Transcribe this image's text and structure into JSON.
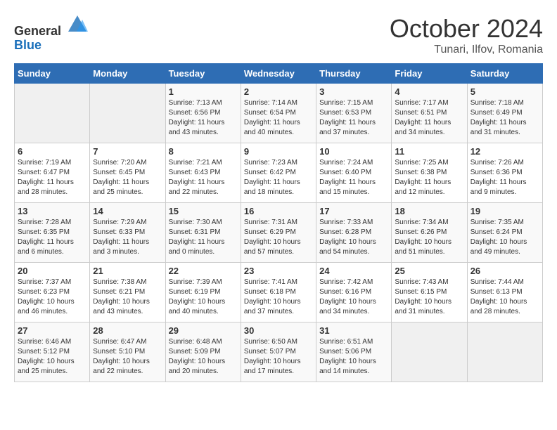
{
  "header": {
    "logo_general": "General",
    "logo_blue": "Blue",
    "month": "October 2024",
    "location": "Tunari, Ilfov, Romania"
  },
  "days_of_week": [
    "Sunday",
    "Monday",
    "Tuesday",
    "Wednesday",
    "Thursday",
    "Friday",
    "Saturday"
  ],
  "weeks": [
    [
      {
        "day": "",
        "empty": true
      },
      {
        "day": "",
        "empty": true
      },
      {
        "day": "1",
        "sunrise": "Sunrise: 7:13 AM",
        "sunset": "Sunset: 6:56 PM",
        "daylight": "Daylight: 11 hours and 43 minutes."
      },
      {
        "day": "2",
        "sunrise": "Sunrise: 7:14 AM",
        "sunset": "Sunset: 6:54 PM",
        "daylight": "Daylight: 11 hours and 40 minutes."
      },
      {
        "day": "3",
        "sunrise": "Sunrise: 7:15 AM",
        "sunset": "Sunset: 6:53 PM",
        "daylight": "Daylight: 11 hours and 37 minutes."
      },
      {
        "day": "4",
        "sunrise": "Sunrise: 7:17 AM",
        "sunset": "Sunset: 6:51 PM",
        "daylight": "Daylight: 11 hours and 34 minutes."
      },
      {
        "day": "5",
        "sunrise": "Sunrise: 7:18 AM",
        "sunset": "Sunset: 6:49 PM",
        "daylight": "Daylight: 11 hours and 31 minutes."
      }
    ],
    [
      {
        "day": "6",
        "sunrise": "Sunrise: 7:19 AM",
        "sunset": "Sunset: 6:47 PM",
        "daylight": "Daylight: 11 hours and 28 minutes."
      },
      {
        "day": "7",
        "sunrise": "Sunrise: 7:20 AM",
        "sunset": "Sunset: 6:45 PM",
        "daylight": "Daylight: 11 hours and 25 minutes."
      },
      {
        "day": "8",
        "sunrise": "Sunrise: 7:21 AM",
        "sunset": "Sunset: 6:43 PM",
        "daylight": "Daylight: 11 hours and 22 minutes."
      },
      {
        "day": "9",
        "sunrise": "Sunrise: 7:23 AM",
        "sunset": "Sunset: 6:42 PM",
        "daylight": "Daylight: 11 hours and 18 minutes."
      },
      {
        "day": "10",
        "sunrise": "Sunrise: 7:24 AM",
        "sunset": "Sunset: 6:40 PM",
        "daylight": "Daylight: 11 hours and 15 minutes."
      },
      {
        "day": "11",
        "sunrise": "Sunrise: 7:25 AM",
        "sunset": "Sunset: 6:38 PM",
        "daylight": "Daylight: 11 hours and 12 minutes."
      },
      {
        "day": "12",
        "sunrise": "Sunrise: 7:26 AM",
        "sunset": "Sunset: 6:36 PM",
        "daylight": "Daylight: 11 hours and 9 minutes."
      }
    ],
    [
      {
        "day": "13",
        "sunrise": "Sunrise: 7:28 AM",
        "sunset": "Sunset: 6:35 PM",
        "daylight": "Daylight: 11 hours and 6 minutes."
      },
      {
        "day": "14",
        "sunrise": "Sunrise: 7:29 AM",
        "sunset": "Sunset: 6:33 PM",
        "daylight": "Daylight: 11 hours and 3 minutes."
      },
      {
        "day": "15",
        "sunrise": "Sunrise: 7:30 AM",
        "sunset": "Sunset: 6:31 PM",
        "daylight": "Daylight: 11 hours and 0 minutes."
      },
      {
        "day": "16",
        "sunrise": "Sunrise: 7:31 AM",
        "sunset": "Sunset: 6:29 PM",
        "daylight": "Daylight: 10 hours and 57 minutes."
      },
      {
        "day": "17",
        "sunrise": "Sunrise: 7:33 AM",
        "sunset": "Sunset: 6:28 PM",
        "daylight": "Daylight: 10 hours and 54 minutes."
      },
      {
        "day": "18",
        "sunrise": "Sunrise: 7:34 AM",
        "sunset": "Sunset: 6:26 PM",
        "daylight": "Daylight: 10 hours and 51 minutes."
      },
      {
        "day": "19",
        "sunrise": "Sunrise: 7:35 AM",
        "sunset": "Sunset: 6:24 PM",
        "daylight": "Daylight: 10 hours and 49 minutes."
      }
    ],
    [
      {
        "day": "20",
        "sunrise": "Sunrise: 7:37 AM",
        "sunset": "Sunset: 6:23 PM",
        "daylight": "Daylight: 10 hours and 46 minutes."
      },
      {
        "day": "21",
        "sunrise": "Sunrise: 7:38 AM",
        "sunset": "Sunset: 6:21 PM",
        "daylight": "Daylight: 10 hours and 43 minutes."
      },
      {
        "day": "22",
        "sunrise": "Sunrise: 7:39 AM",
        "sunset": "Sunset: 6:19 PM",
        "daylight": "Daylight: 10 hours and 40 minutes."
      },
      {
        "day": "23",
        "sunrise": "Sunrise: 7:41 AM",
        "sunset": "Sunset: 6:18 PM",
        "daylight": "Daylight: 10 hours and 37 minutes."
      },
      {
        "day": "24",
        "sunrise": "Sunrise: 7:42 AM",
        "sunset": "Sunset: 6:16 PM",
        "daylight": "Daylight: 10 hours and 34 minutes."
      },
      {
        "day": "25",
        "sunrise": "Sunrise: 7:43 AM",
        "sunset": "Sunset: 6:15 PM",
        "daylight": "Daylight: 10 hours and 31 minutes."
      },
      {
        "day": "26",
        "sunrise": "Sunrise: 7:44 AM",
        "sunset": "Sunset: 6:13 PM",
        "daylight": "Daylight: 10 hours and 28 minutes."
      }
    ],
    [
      {
        "day": "27",
        "sunrise": "Sunrise: 6:46 AM",
        "sunset": "Sunset: 5:12 PM",
        "daylight": "Daylight: 10 hours and 25 minutes."
      },
      {
        "day": "28",
        "sunrise": "Sunrise: 6:47 AM",
        "sunset": "Sunset: 5:10 PM",
        "daylight": "Daylight: 10 hours and 22 minutes."
      },
      {
        "day": "29",
        "sunrise": "Sunrise: 6:48 AM",
        "sunset": "Sunset: 5:09 PM",
        "daylight": "Daylight: 10 hours and 20 minutes."
      },
      {
        "day": "30",
        "sunrise": "Sunrise: 6:50 AM",
        "sunset": "Sunset: 5:07 PM",
        "daylight": "Daylight: 10 hours and 17 minutes."
      },
      {
        "day": "31",
        "sunrise": "Sunrise: 6:51 AM",
        "sunset": "Sunset: 5:06 PM",
        "daylight": "Daylight: 10 hours and 14 minutes."
      },
      {
        "day": "",
        "empty": true
      },
      {
        "day": "",
        "empty": true
      }
    ]
  ]
}
